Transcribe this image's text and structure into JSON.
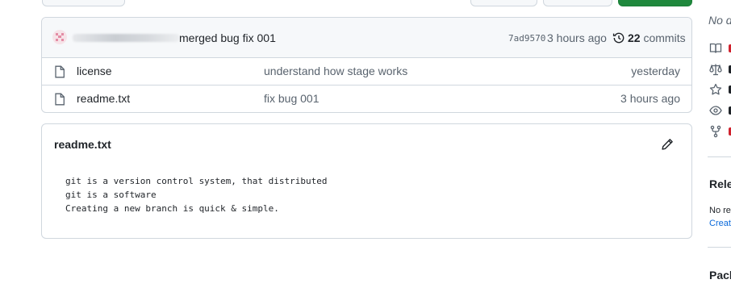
{
  "commit": {
    "message": "merged bug fix 001",
    "sha": "7ad9570",
    "time": "3 hours ago",
    "count_number": "22",
    "count_label": " commits"
  },
  "files": [
    {
      "name": "license",
      "message": "understand how stage works",
      "date": "yesterday"
    },
    {
      "name": "readme.txt",
      "message": "fix bug 001",
      "date": "3 hours ago"
    }
  ],
  "readme": {
    "title": "readme.txt",
    "content": "git is a version control system, that distributed\ngit is a software\nCreating a new branch is quick & simple."
  },
  "sidebar": {
    "about_placeholder": "No d",
    "releases_heading": "Rele",
    "releases_text": "No re",
    "releases_link": "Create",
    "packages_heading": "Pack"
  },
  "colors": {
    "accent_link": "#0969da",
    "muted_text": "#59636e",
    "border": "#d0d7de",
    "primary_button": "#1f883d"
  },
  "icons": [
    "file-icon",
    "history-icon",
    "pencil-icon",
    "book-icon",
    "scale-icon",
    "star-icon",
    "eye-icon",
    "fork-icon"
  ]
}
